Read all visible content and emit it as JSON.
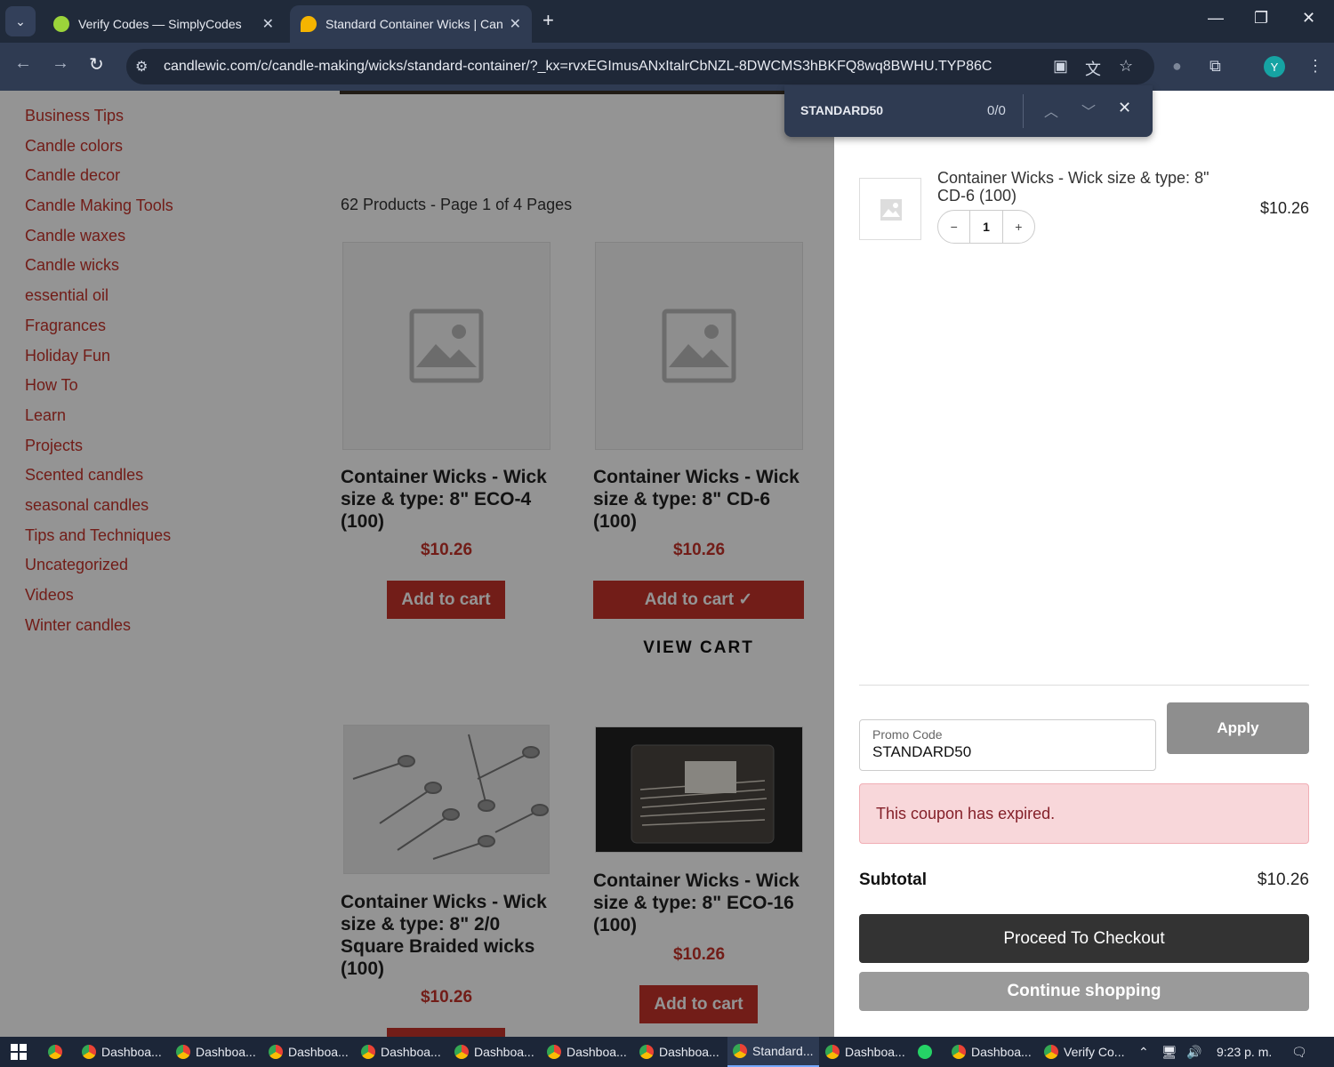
{
  "browser": {
    "tabs": [
      {
        "title": "Verify Codes — SimplyCodes",
        "active": false
      },
      {
        "title": "Standard Container Wicks | Can",
        "active": true
      }
    ],
    "url": "candlewic.com/c/candle-making/wicks/standard-container/?_kx=rvxEGImusANxItalrCbNZL-8DWCMS3hBKFQ8wq8BWHU.TYP86C",
    "avatar_letter": "Y",
    "find": {
      "query": "STANDARD50",
      "count": "0/0"
    }
  },
  "sidebar": {
    "categories": [
      "Business Tips",
      "Candle colors",
      "Candle decor",
      "Candle Making Tools",
      "Candle waxes",
      "Candle wicks",
      "essential oil",
      "Fragrances",
      "Holiday Fun",
      "How To",
      "Learn",
      "Projects",
      "Scented candles",
      "seasonal candles",
      "Tips and Techniques",
      "Uncategorized",
      "Videos",
      "Winter candles"
    ]
  },
  "listing": {
    "count_text": "62 Products - Page 1 of 4 Pages",
    "products": [
      {
        "title": "Container Wicks - Wick size & type: 8\" ECO-4 (100)",
        "price": "$10.26",
        "button": "Add to cart"
      },
      {
        "title": "Container Wicks - Wick size & type: 8\" CD-6 (100)",
        "price": "$10.26",
        "button": "Add to cart ✓",
        "view_cart": "VIEW CART"
      },
      {
        "title": "Container Wicks - Wick size & type: 8\" 2/0 Square Braided wicks (100)",
        "price": "$10.26",
        "button": ""
      },
      {
        "title": "Container Wicks - Wick size & type: 8\" ECO-16 (100)",
        "price": "$10.26",
        "button": "Add to cart"
      }
    ]
  },
  "cart": {
    "item": {
      "title": "Container Wicks - Wick size & type: 8\" CD-6 (100)",
      "price": "$10.26",
      "qty": "1",
      "minus": "−",
      "plus": "+"
    },
    "promo": {
      "label": "Promo Code",
      "value": "STANDARD50",
      "apply": "Apply"
    },
    "alert": "This coupon has expired.",
    "subtotal_label": "Subtotal",
    "subtotal_value": "$10.26",
    "checkout": "Proceed To Checkout",
    "continue": "Continue shopping"
  },
  "taskbar": {
    "items": [
      "Dashboa...",
      "Dashboa...",
      "Dashboa...",
      "Dashboa...",
      "Dashboa...",
      "Dashboa...",
      "Dashboa...",
      "Standard...",
      "Dashboa...",
      "Dashboa...",
      "Verify Co..."
    ],
    "time": "9:23 p. m."
  }
}
